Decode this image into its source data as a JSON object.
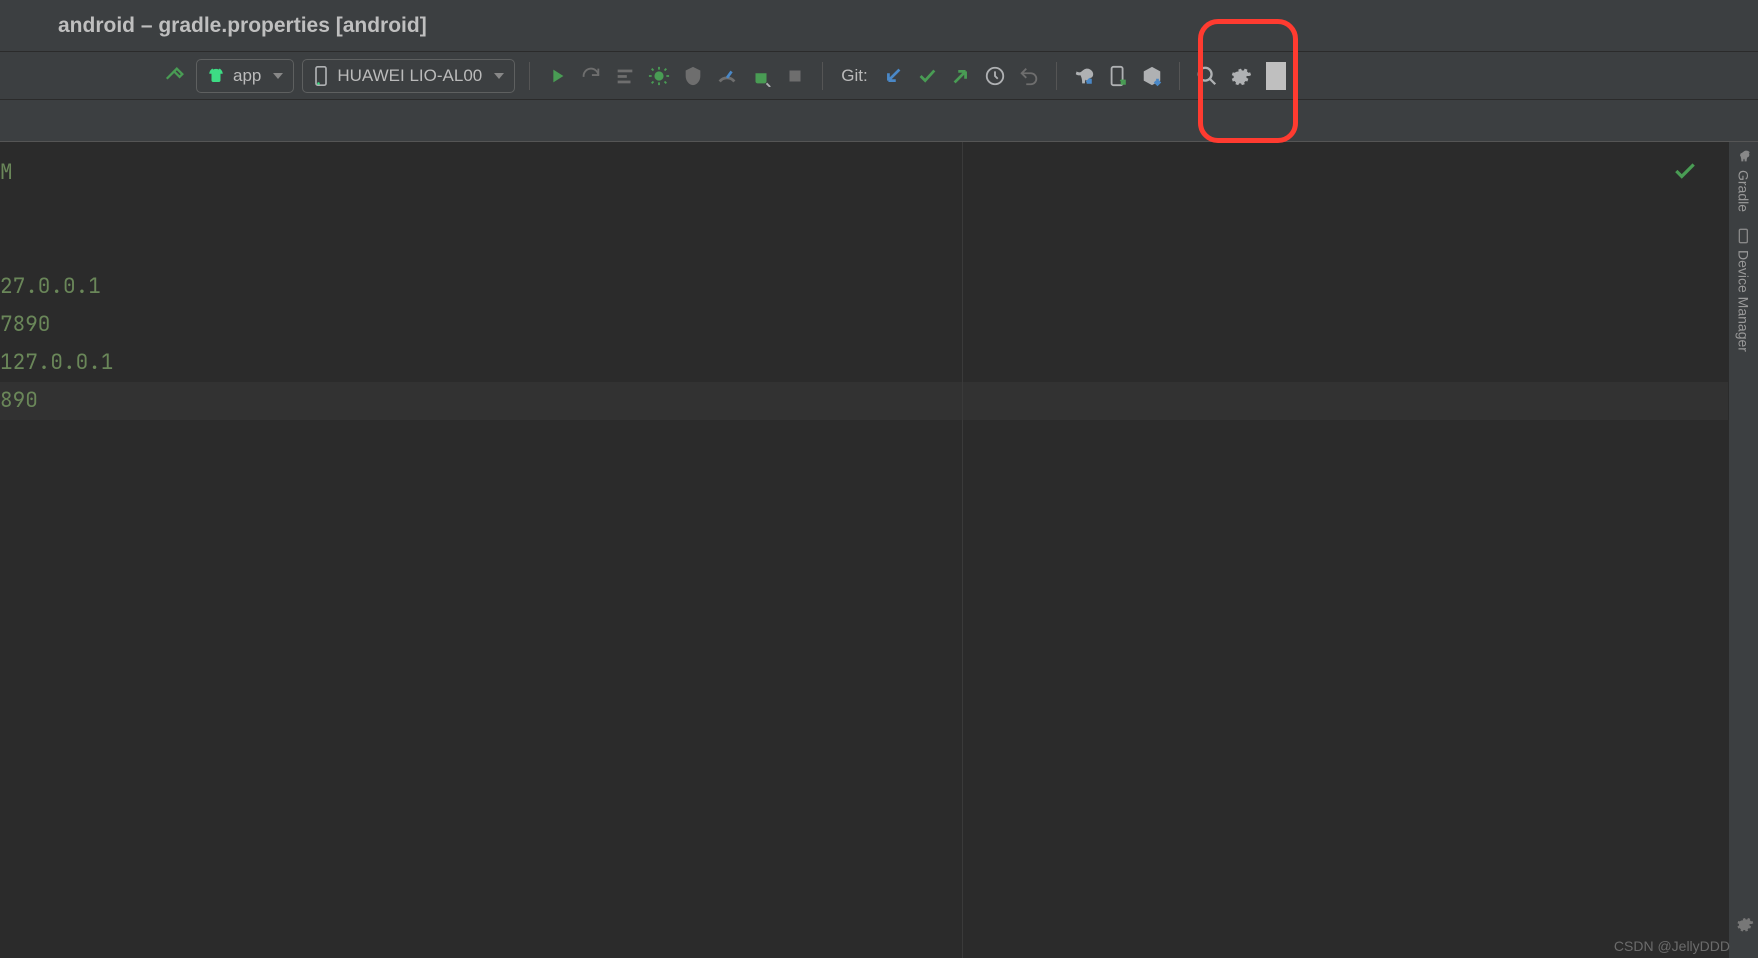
{
  "title": "android – gradle.properties [android]",
  "toolbar": {
    "module_label": "app",
    "device_label": "HUAWEI LIO-AL00",
    "git_label": "Git:"
  },
  "editor": {
    "lines": [
      "M",
      "",
      "",
      "27.0.0.1",
      "7890",
      "127.0.0.1",
      "890"
    ],
    "highlighted_index": 6
  },
  "right_stripe": {
    "tab1": "Gradle",
    "tab2": "Device Manager"
  },
  "watermark": "CSDN @JellyDDD"
}
